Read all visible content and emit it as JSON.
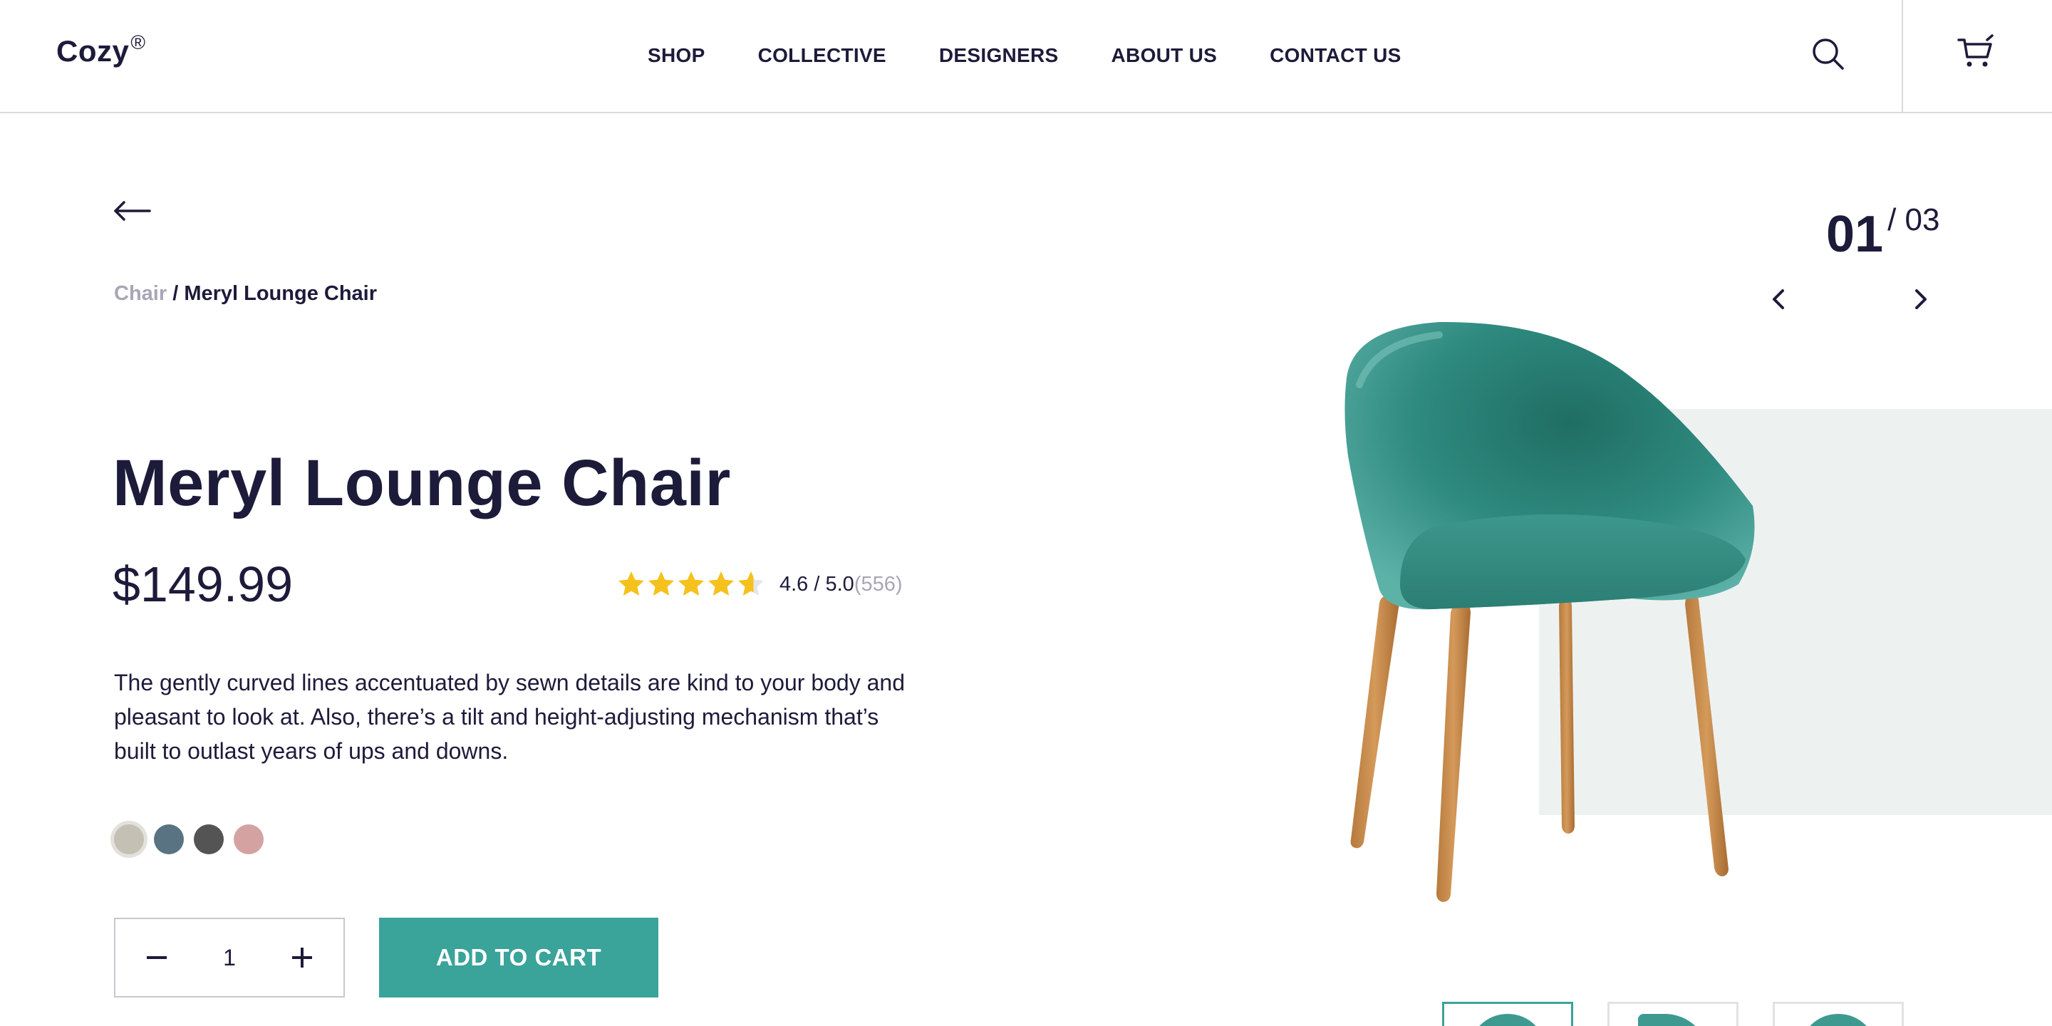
{
  "header": {
    "logo": "Cozy",
    "logo_mark": "®",
    "nav": [
      "SHOP",
      "COLLECTIVE",
      "DESIGNERS",
      "ABOUT US",
      "CONTACT US"
    ],
    "icons": [
      "search-icon",
      "cart-icon"
    ]
  },
  "breadcrumb": {
    "parent": "Chair",
    "separator": " / ",
    "current": "Meryl Lounge Chair"
  },
  "product": {
    "title": "Meryl Lounge Chair",
    "price": "$149.99",
    "rating": {
      "stars": 4.6,
      "value_text": "4.6 / 5.0",
      "count_text": "(556)"
    },
    "description": "The gently curved lines accentuated by sewn details are kind to your body and pleasant to look at. Also, there’s a tilt and height-adjusting mechanism that’s built to outlast years of ups and downs.",
    "swatches": [
      {
        "name": "beige",
        "color": "#c4c0b4",
        "selected": true
      },
      {
        "name": "slate-blue",
        "color": "#5a7383",
        "selected": false
      },
      {
        "name": "charcoal",
        "color": "#545454",
        "selected": false
      },
      {
        "name": "dusty-pink",
        "color": "#d5a2a2",
        "selected": false
      }
    ],
    "quantity": "1",
    "add_to_cart_label": "ADD TO CART"
  },
  "gallery": {
    "current": "01",
    "total": "/ 03",
    "thumbnails": 3,
    "active_thumbnail": 0
  },
  "colors": {
    "accent": "#3aa39a",
    "text": "#1d1b3a",
    "muted": "#a8a6b6",
    "star": "#f5c11c",
    "panel": "#edf2f1"
  }
}
